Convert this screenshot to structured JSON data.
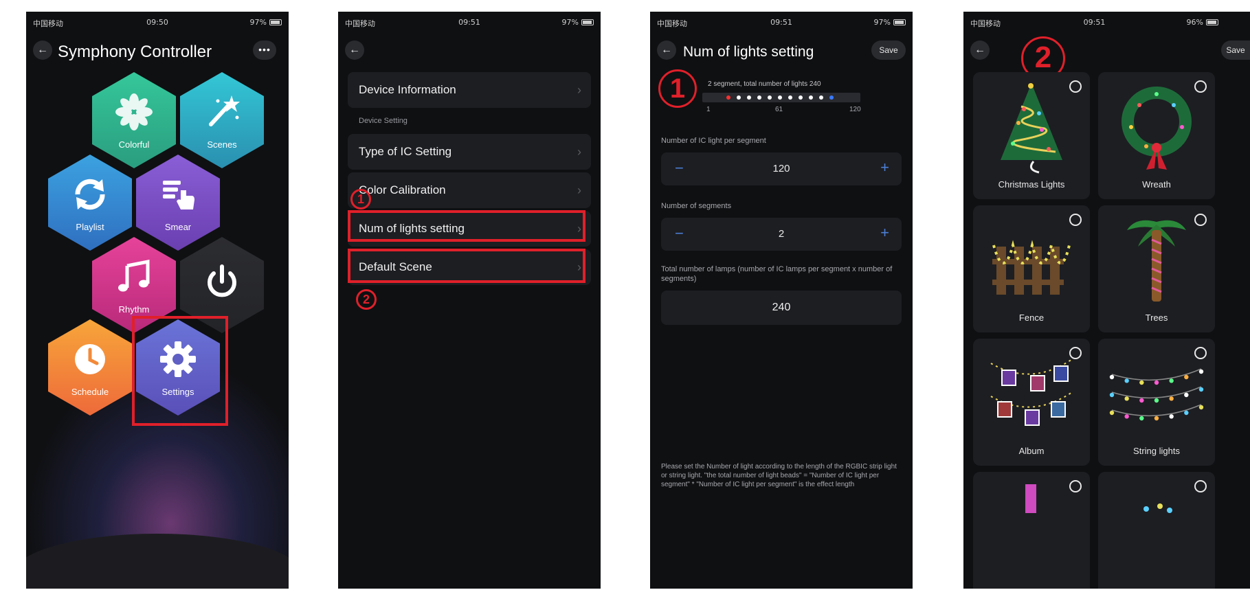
{
  "status_bars": [
    {
      "carrier": "中国移动",
      "time": "09:50",
      "battery": "97%"
    },
    {
      "carrier": "中国移动",
      "time": "09:51",
      "battery": "97%"
    },
    {
      "carrier": "中国移动",
      "time": "09:51",
      "battery": "97%"
    },
    {
      "carrier": "中国移动",
      "time": "09:51",
      "battery": "96%"
    }
  ],
  "panel1": {
    "title": "Symphony Controller",
    "menu_label": "•••",
    "tiles": [
      {
        "label": "Colorful",
        "icon": "flower-icon",
        "color_top": "#35c79a",
        "color_bottom": "#2a9d7f"
      },
      {
        "label": "Scenes",
        "icon": "magic-wand-icon",
        "color_top": "#33c7d6",
        "color_bottom": "#2a8fb0"
      },
      {
        "label": "Playlist",
        "icon": "cycle-arrows-icon",
        "color_top": "#3ca2e0",
        "color_bottom": "#2f6fc0"
      },
      {
        "label": "Smear",
        "icon": "smear-hand-icon",
        "color_top": "#8a5ed6",
        "color_bottom": "#6a3fb0"
      },
      {
        "label": "Rhythm",
        "icon": "music-note-icon",
        "color_top": "#e6439a",
        "color_bottom": "#b8297a"
      },
      {
        "label": "",
        "icon": "power-icon",
        "color_top": "#2c2d31",
        "color_bottom": "#232428"
      },
      {
        "label": "Schedule",
        "icon": "clock-icon",
        "color_top": "#f7a53a",
        "color_bottom": "#ee6a3a"
      },
      {
        "label": "Settings",
        "icon": "gear-icon",
        "color_top": "#6a74d8",
        "color_bottom": "#5a4fb8"
      }
    ]
  },
  "panel2": {
    "rows": [
      {
        "label": "Device Information"
      },
      {
        "label": "Type of IC Setting"
      },
      {
        "label": "Color Calibration"
      },
      {
        "label": "Num of lights setting"
      },
      {
        "label": "Default Scene"
      }
    ],
    "section_label": "Device Setting",
    "annotations": [
      "1",
      "2"
    ]
  },
  "panel3": {
    "title": "Num of lights setting",
    "save_label": "Save",
    "annotation": "1",
    "segment_summary": "2 segment,  total number of lights 240",
    "strip_ticks": [
      "1",
      "61",
      "120"
    ],
    "per_segment_label": "Number of IC light per segment",
    "per_segment_value": "120",
    "segments_label": "Number of segments",
    "segments_value": "2",
    "total_label": "Total number of lamps (number of IC lamps per segment x number of segments)",
    "total_value": "240",
    "minus_symbol": "−",
    "plus_symbol": "+",
    "footnote": "Please set the Number of light according to the length of the RGBIC strip light or string light. \"the total number of light beads\" = \"Number of IC light per segment\" * \"Number of IC light per segment\" is the effect length"
  },
  "panel4": {
    "save_label": "Save",
    "annotation": "2",
    "scenes": [
      {
        "label": "Christmas Lights",
        "icon": "christmas-tree-icon"
      },
      {
        "label": "Wreath",
        "icon": "wreath-icon"
      },
      {
        "label": "Fence",
        "icon": "fence-icon"
      },
      {
        "label": "Trees",
        "icon": "palm-tree-icon"
      },
      {
        "label": "Album",
        "icon": "photo-garland-icon"
      },
      {
        "label": "String lights",
        "icon": "string-lights-icon"
      },
      {
        "label": "",
        "icon": "lamp-icon"
      },
      {
        "label": "",
        "icon": "lights-icon"
      }
    ]
  },
  "colors": {
    "background": "#0f1012",
    "card": "#1d1e22",
    "accent": "#4c7fd6",
    "annotation_red": "#e0202a"
  }
}
